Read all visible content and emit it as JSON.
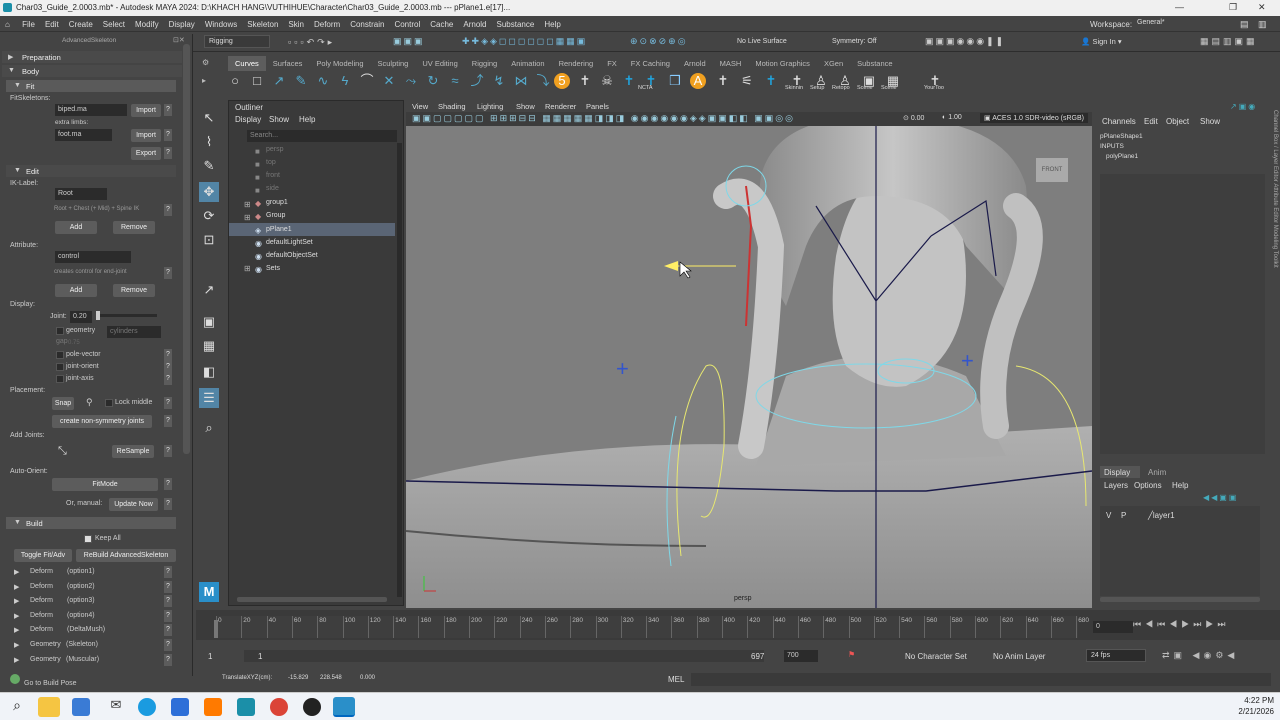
{
  "window": {
    "title": "Char03_Guide_2.0003.mb* - Autodesk MAYA 2024: D:\\KHACH HANG\\VUTHIHUE\\Character\\Char03_Guide_2.0003.mb   ---   pPlane1.e[17]..."
  },
  "menu": [
    "File",
    "Edit",
    "Create",
    "Select",
    "Modify",
    "Display",
    "Windows",
    "Skeleton",
    "Skin",
    "Deform",
    "Constrain",
    "Control",
    "Cache",
    "Arnold",
    "Substance",
    "Help"
  ],
  "workspace": {
    "label": "Workspace:",
    "value": "General*"
  },
  "status": {
    "mode": "Rigging",
    "live": "No Live Surface",
    "symmetry": "Symmetry: Off",
    "signin": "Sign In"
  },
  "shelf_tabs": [
    "Curves",
    "Surfaces",
    "Poly Modeling",
    "Sculpting",
    "UV Editing",
    "Rigging",
    "Animation",
    "Rendering",
    "FX",
    "FX Caching",
    "Arnold",
    "MASH",
    "Motion Graphics",
    "XGen",
    "Substance"
  ],
  "shelf_labels": [
    "NCTA",
    "Skinnin",
    "Setup",
    "Retopo",
    "Scene",
    "Scene",
    "YourToo"
  ],
  "as": {
    "title": "AdvancedSkeleton",
    "preparation": "Preparation",
    "body": "Body",
    "fit": "Fit",
    "fit_skeletons": "FitSkeletons:",
    "fit_file": "biped.ma",
    "import": "Import",
    "extra_limbs": "extra limbs:",
    "extra_file": "foot.ma",
    "import2": "Import",
    "export": "Export",
    "edit": "Edit",
    "ik_label": "IK-Label:",
    "ik_value": "Root",
    "ik_hint": "Root + Chest (+ Mid) + Spine IK",
    "add": "Add",
    "remove": "Remove",
    "attribute": "Attribute:",
    "attr_value": "control",
    "attr_hint": "creates control for end-joint",
    "add2": "Add",
    "remove2": "Remove",
    "display": "Display:",
    "joint": "Joint:",
    "joint_val": "0.20",
    "geometry": "geometry",
    "cylinders": "cylinders",
    "gap": "gap",
    "gap_val": "0.75",
    "pole": "pole-vector",
    "orient": "joint-orient",
    "axis": "joint-axis",
    "placement": "Placement:",
    "snap": "Snap",
    "lock_middle": "Lock middle",
    "sym": "create non-symmetry joints",
    "add_joints": "Add Joints:",
    "resample": "ReSample",
    "auto_orient": "Auto-Orient:",
    "fitmode": "FitMode",
    "or_manual": "Or, manual:",
    "update": "Update Now",
    "build": "Build",
    "keep_all": "Keep All",
    "toggle": "Toggle Fit/Adv",
    "rebuild": "ReBuild AdvancedSkeleton",
    "deforms": [
      [
        "Deform",
        "(option1)"
      ],
      [
        "Deform",
        "(option2)"
      ],
      [
        "Deform",
        "(option3)"
      ],
      [
        "Deform",
        "(option4)"
      ],
      [
        "Deform",
        "(DeltaMush)"
      ],
      [
        "Geometry",
        "(Skeleton)"
      ],
      [
        "Geometry",
        "(Muscular)"
      ]
    ],
    "go_build": "Go to Build Pose"
  },
  "outliner": {
    "title": "Outliner",
    "menu": [
      "Display",
      "Show",
      "Help"
    ],
    "search": "Search...",
    "items": [
      "persp",
      "top",
      "front",
      "side",
      "group1",
      "Group",
      "pPlane1",
      "defaultLightSet",
      "defaultObjectSet",
      "Sets"
    ]
  },
  "viewport": {
    "menu": [
      "View",
      "Shading",
      "Lighting",
      "Show",
      "Renderer",
      "Panels"
    ],
    "val1": "0.00",
    "val2": "1.00",
    "colorspace": "ACES 1.0 SDR-video (sRGB)",
    "cube": "FRONT",
    "camera": "persp"
  },
  "channel": {
    "tabs": [
      "Channels",
      "Edit",
      "Object",
      "Show"
    ],
    "shape": "pPlaneShape1",
    "inputs": "INPUTS",
    "poly": "polyPlane1",
    "layer_tabs": [
      "Display",
      "Anim"
    ],
    "layer_menu": [
      "Layers",
      "Options",
      "Help"
    ],
    "layer_v": "V",
    "layer_p": "P",
    "layer_name": "layer1",
    "side_tabs": [
      "Channel Box / Layer Editor",
      "Attribute Editor",
      "Modeling Toolkit"
    ]
  },
  "timeline": {
    "ticks": [
      "0",
      "20",
      "40",
      "60",
      "80",
      "100",
      "120",
      "140",
      "160",
      "180",
      "200",
      "220",
      "240",
      "260",
      "280",
      "300",
      "320",
      "340",
      "360",
      "380",
      "400",
      "420",
      "440",
      "460",
      "480",
      "500",
      "520",
      "540",
      "560",
      "580",
      "600",
      "620",
      "640",
      "660",
      "680"
    ],
    "current": "0"
  },
  "range": {
    "start": "1",
    "start2": "1",
    "end_inner": "697",
    "end": "700",
    "char": "No Character Set",
    "anim": "No Anim Layer",
    "fps": "24 fps"
  },
  "cmd": {
    "help": "TranslateXYZ(cm):",
    "x": "-15.829",
    "y": "228.548",
    "z": "0.000",
    "lang": "MEL"
  },
  "taskbar": {
    "time": "4:22 PM",
    "date": "2/21/2026"
  },
  "colors": {
    "accent": "#5285a6",
    "shelf_blue": "#21a5e0",
    "orange": "#f0a020"
  }
}
